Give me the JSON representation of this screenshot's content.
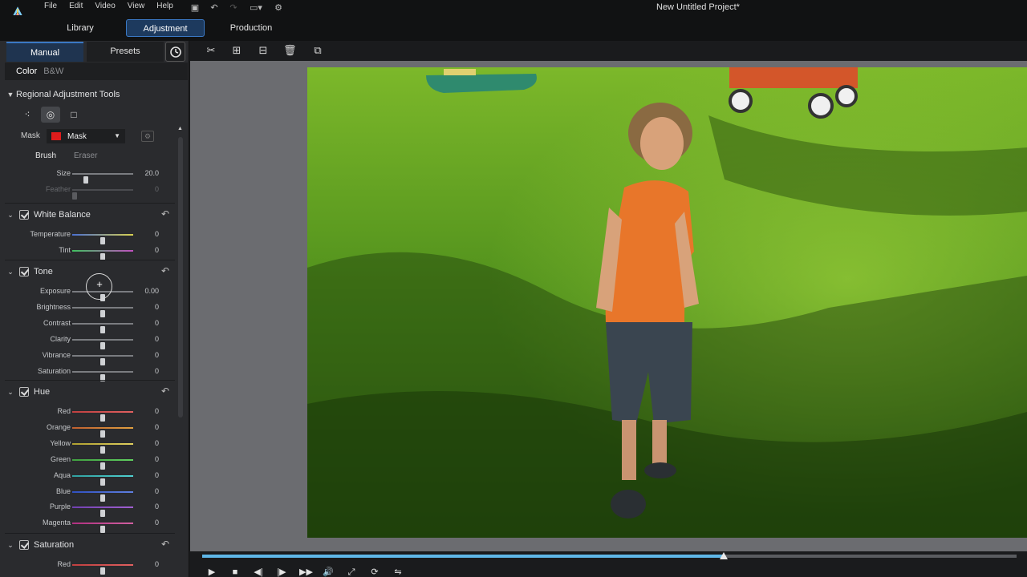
{
  "menu": {
    "items": [
      "File",
      "Edit",
      "Video",
      "View",
      "Help"
    ],
    "project_title": "New Untitled Project*"
  },
  "modules": {
    "library": "Library",
    "adjustment": "Adjustment",
    "production": "Production"
  },
  "panel_tabs": {
    "manual": "Manual",
    "presets": "Presets"
  },
  "mode": {
    "color": "Color",
    "bw": "B&W"
  },
  "regional": {
    "title": "Regional Adjustment Tools",
    "mask_label": "Mask",
    "mask_value": "Mask",
    "mask_color": "#e01c1c",
    "brush": "Brush",
    "eraser": "Eraser",
    "size_label": "Size",
    "size_value": "20.0",
    "size_level": 0.2,
    "feather_label": "Feather",
    "feather_value": "0",
    "feather_level": 0.0
  },
  "white_balance": {
    "title": "White Balance",
    "rows": [
      {
        "label": "Temperature",
        "value": "0"
      },
      {
        "label": "Tint",
        "value": "0"
      }
    ]
  },
  "tone": {
    "title": "Tone",
    "rows": [
      {
        "label": "Exposure",
        "value": "0.00"
      },
      {
        "label": "Brightness",
        "value": "0"
      },
      {
        "label": "Contrast",
        "value": "0"
      },
      {
        "label": "Clarity",
        "value": "0"
      },
      {
        "label": "Vibrance",
        "value": "0"
      },
      {
        "label": "Saturation",
        "value": "0"
      }
    ]
  },
  "hue": {
    "title": "Hue",
    "rows": [
      {
        "label": "Red",
        "value": "0"
      },
      {
        "label": "Orange",
        "value": "0"
      },
      {
        "label": "Yellow",
        "value": "0"
      },
      {
        "label": "Green",
        "value": "0"
      },
      {
        "label": "Aqua",
        "value": "0"
      },
      {
        "label": "Blue",
        "value": "0"
      },
      {
        "label": "Purple",
        "value": "0"
      },
      {
        "label": "Magenta",
        "value": "0"
      }
    ]
  },
  "saturation": {
    "title": "Saturation",
    "rows": [
      {
        "label": "Red",
        "value": "0"
      }
    ]
  },
  "timeline": {
    "progress": 0.64
  },
  "colors": {
    "accent": "#3a78c4",
    "timeline_progress": "#5fb7e8"
  }
}
